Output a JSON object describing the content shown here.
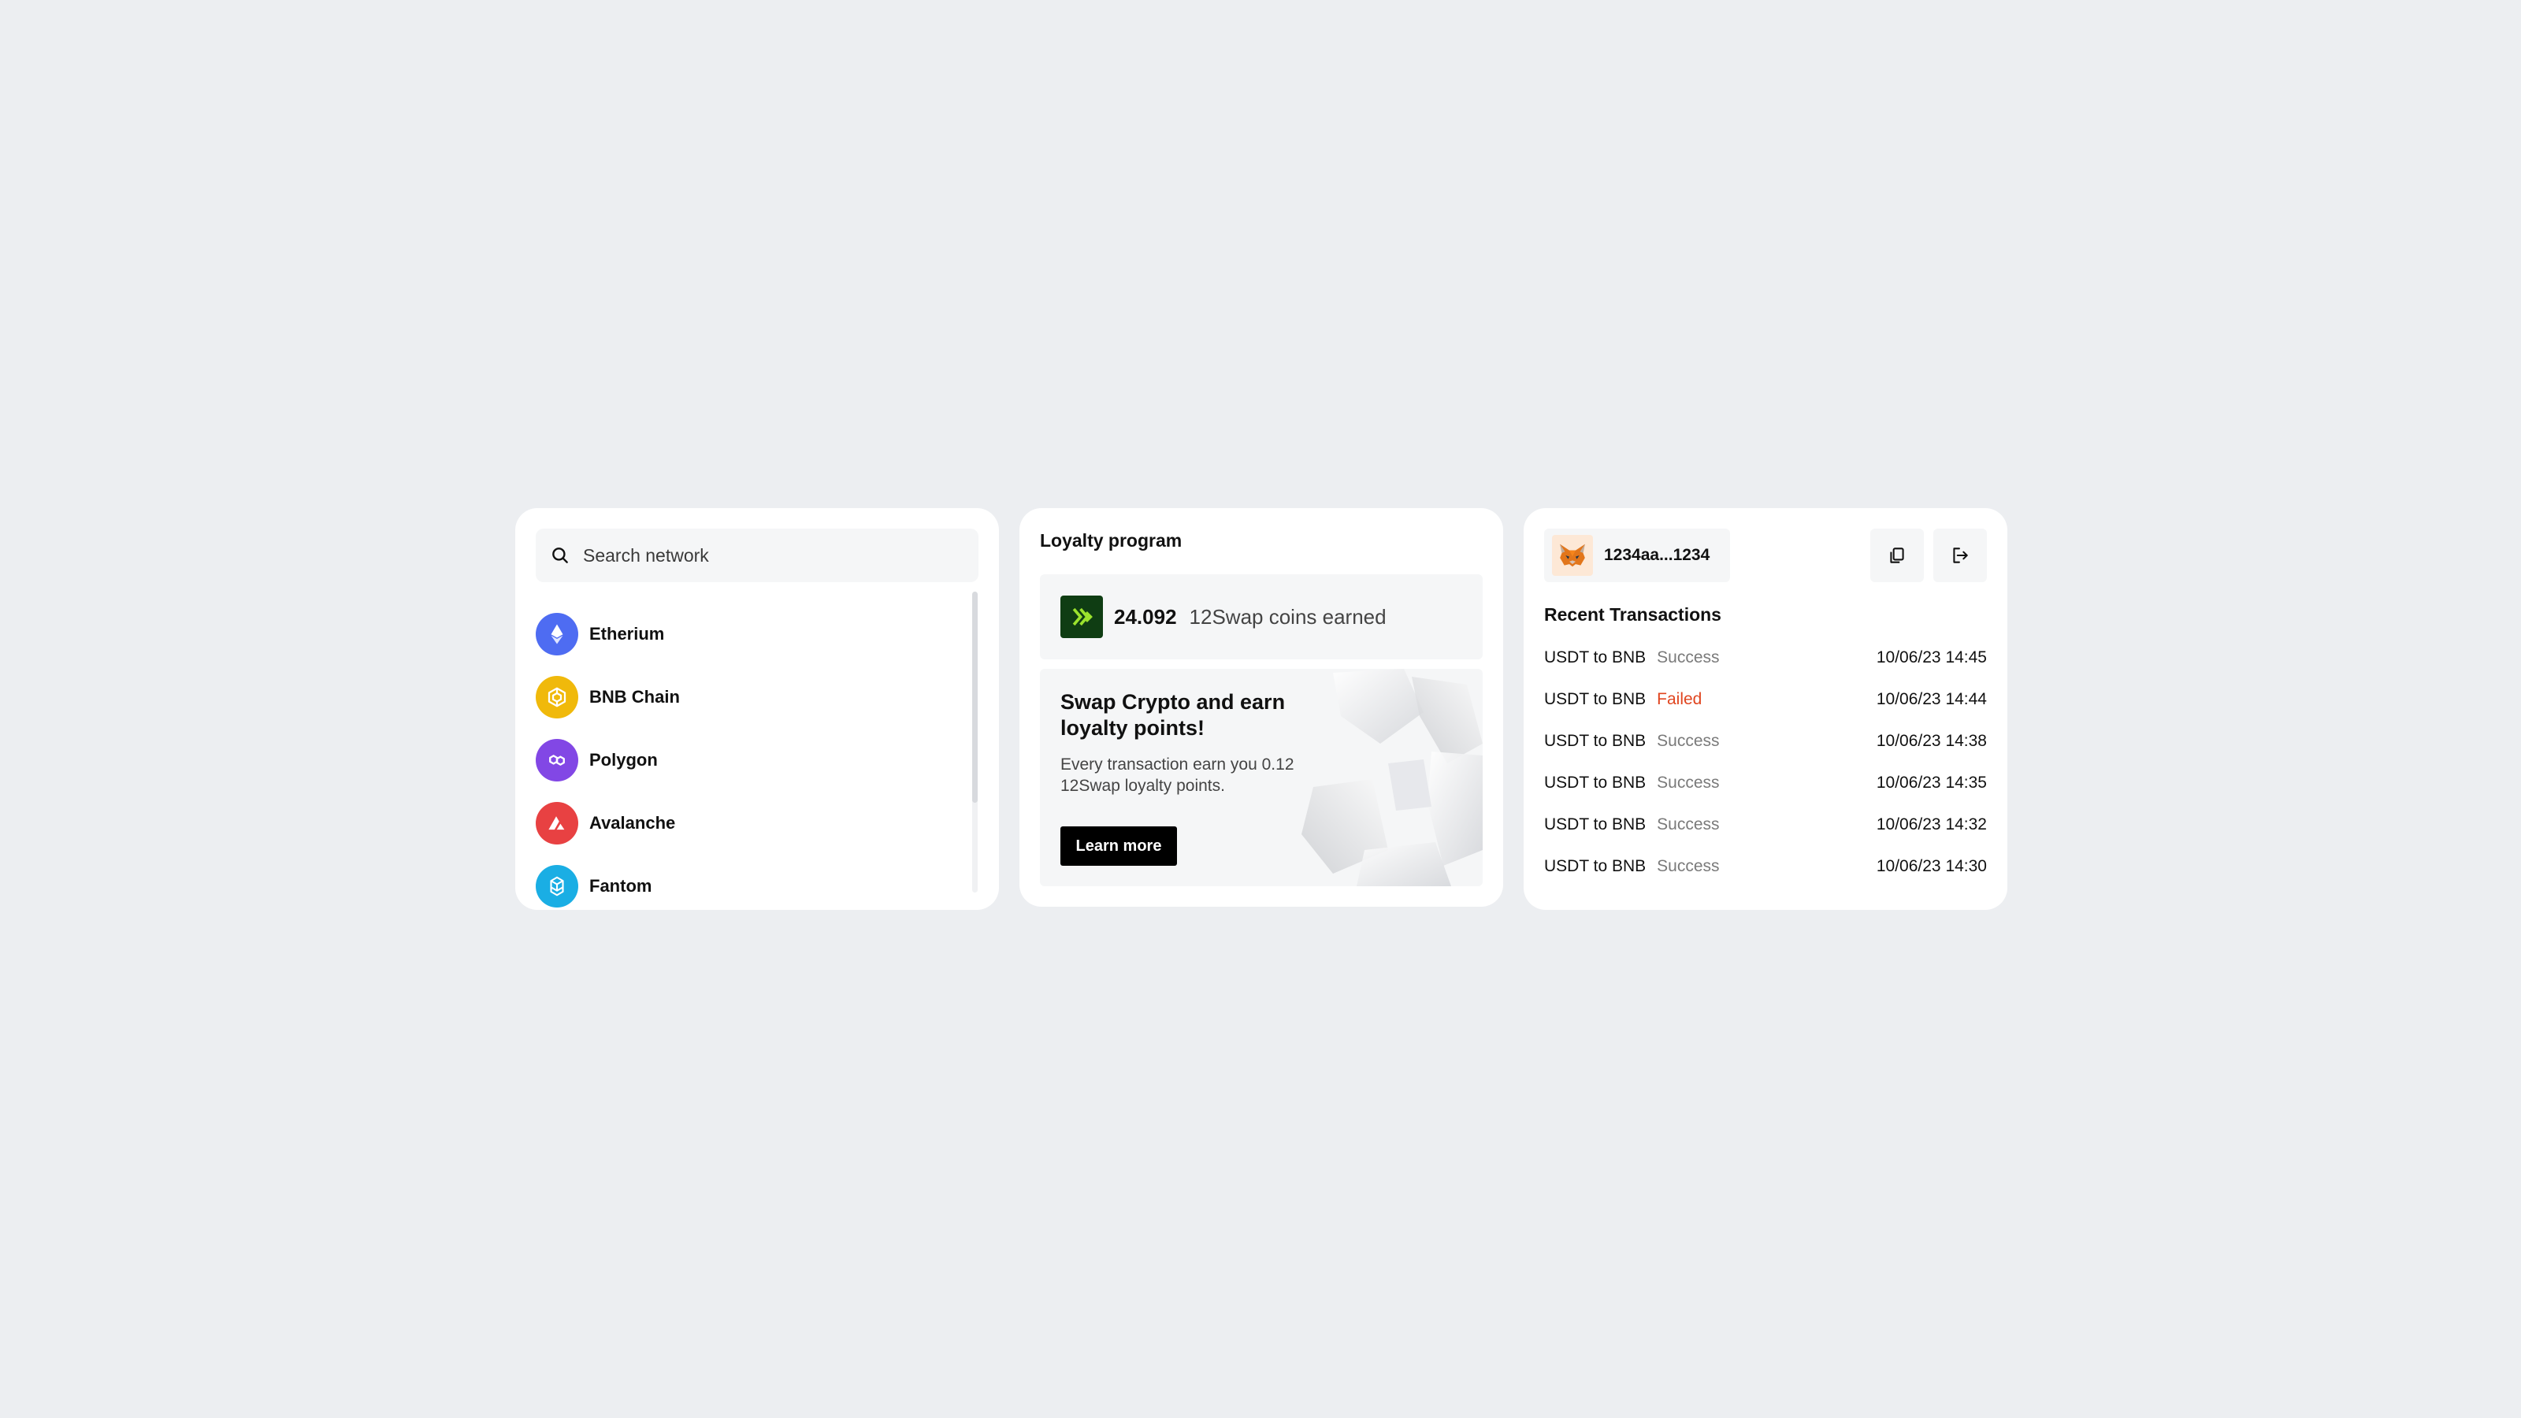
{
  "networks_panel": {
    "search_placeholder": "Search network",
    "items": [
      {
        "label": "Etherium",
        "icon": "ethereum-icon",
        "color": "#4e6cf2"
      },
      {
        "label": "BNB Chain",
        "icon": "bnb-icon",
        "color": "#f0b90b"
      },
      {
        "label": "Polygon",
        "icon": "polygon-icon",
        "color": "#8247e5"
      },
      {
        "label": "Avalanche",
        "icon": "avalanche-icon",
        "color": "#e84142"
      },
      {
        "label": "Fantom",
        "icon": "fantom-icon",
        "color": "#1aaee4"
      }
    ]
  },
  "loyalty_panel": {
    "title": "Loyalty program",
    "coins_amount": "24.092",
    "coins_label": "12Swap coins earned",
    "accent_color": "#9be22d",
    "promo": {
      "title": "Swap Crypto and earn loyalty points!",
      "description": "Every transaction earn you 0.12 12Swap loyalty points.",
      "button_label": "Learn more"
    }
  },
  "wallet_panel": {
    "address": "1234aa...1234",
    "wallet_icon": "metamask-fox-icon",
    "transactions_title": "Recent Transactions",
    "transactions": [
      {
        "pair": "USDT to BNB",
        "status": "Success",
        "time": "10/06/23 14:45"
      },
      {
        "pair": "USDT to BNB",
        "status": "Failed",
        "time": "10/06/23 14:44"
      },
      {
        "pair": "USDT to BNB",
        "status": "Success",
        "time": "10/06/23 14:38"
      },
      {
        "pair": "USDT to BNB",
        "status": "Success",
        "time": "10/06/23 14:35"
      },
      {
        "pair": "USDT to BNB",
        "status": "Success",
        "time": "10/06/23 14:32"
      },
      {
        "pair": "USDT to BNB",
        "status": "Success",
        "time": "10/06/23 14:30"
      }
    ],
    "status_colors": {
      "Success": "#7a7a7a",
      "Failed": "#e0451f"
    }
  }
}
